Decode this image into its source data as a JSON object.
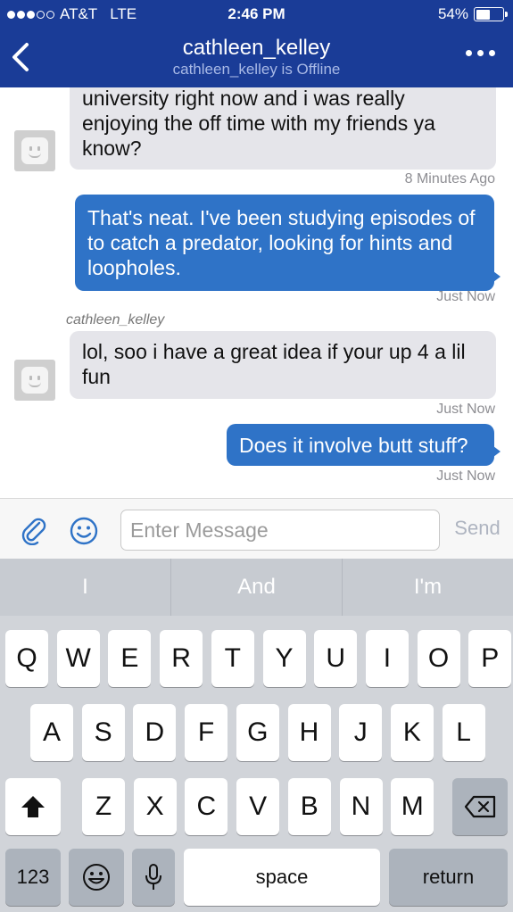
{
  "status_bar": {
    "carrier": "AT&T",
    "network": "LTE",
    "time": "2:46 PM",
    "battery": "54%",
    "battery_level": 0.54
  },
  "nav": {
    "title": "cathleen_kelley",
    "subtitle": "cathleen_kelley is Offline"
  },
  "messages": [
    {
      "direction": "incoming",
      "text": "university right now and i was really enjoying the off time with my friends ya know?",
      "timestamp": "8 Minutes Ago"
    },
    {
      "direction": "outgoing",
      "text": "That's neat. I've been studying episodes of to catch a predator, looking for hints and loopholes.",
      "timestamp": "Just Now"
    },
    {
      "direction": "incoming",
      "sender": "cathleen_kelley",
      "text": "lol, soo i have a great idea if your up 4 a lil fun",
      "timestamp": "Just Now"
    },
    {
      "direction": "outgoing",
      "text": "Does it involve butt stuff?",
      "timestamp": "Just Now"
    }
  ],
  "composer": {
    "placeholder": "Enter Message",
    "send_label": "Send"
  },
  "keyboard": {
    "predictions": [
      "I",
      "And",
      "I'm"
    ],
    "row1": [
      "Q",
      "W",
      "E",
      "R",
      "T",
      "Y",
      "U",
      "I",
      "O",
      "P"
    ],
    "row2": [
      "A",
      "S",
      "D",
      "F",
      "G",
      "H",
      "J",
      "K",
      "L"
    ],
    "row3": [
      "Z",
      "X",
      "C",
      "V",
      "B",
      "N",
      "M"
    ],
    "numbers_label": "123",
    "space_label": "space",
    "return_label": "return"
  }
}
